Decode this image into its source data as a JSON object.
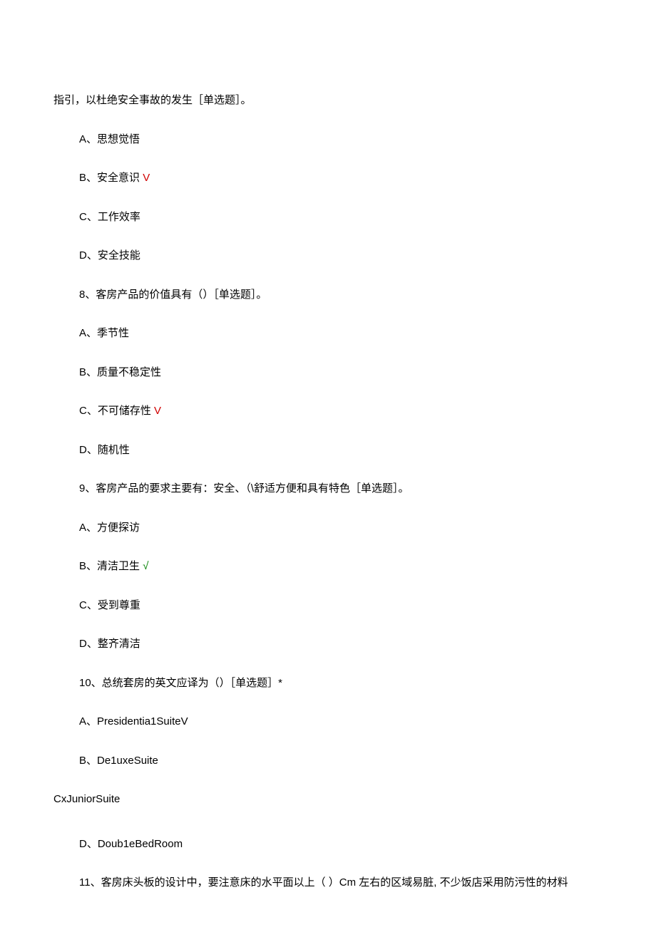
{
  "continued_line": "指引，以杜绝安全事故的发生［单选题］。",
  "q7_options": {
    "A": {
      "text": "A、思想觉悟",
      "mark": ""
    },
    "B": {
      "text": "B、安全意识 ",
      "mark": "V",
      "mark_color": "red"
    },
    "C": {
      "text": "C、工作效率",
      "mark": ""
    },
    "D": {
      "text": "D、安全技能",
      "mark": ""
    }
  },
  "q8": {
    "stem": "8、客房产品的价值具有（）［单选题］。",
    "A": {
      "text": "A、季节性",
      "mark": ""
    },
    "B": {
      "text": "B、质量不稳定性",
      "mark": ""
    },
    "C": {
      "text": "C、不可储存性 ",
      "mark": "V",
      "mark_color": "red"
    },
    "D": {
      "text": "D、随机性",
      "mark": ""
    }
  },
  "q9": {
    "stem": "9、客房产品的要求主要有：安全、（\\舒适方便和具有特色［单选题］。",
    "A": {
      "text": "A、方便探访",
      "mark": ""
    },
    "B": {
      "text": "B、清洁卫生 ",
      "mark": "√",
      "mark_color": "green"
    },
    "C": {
      "text": "C、受到尊重",
      "mark": ""
    },
    "D": {
      "text": "D、整齐清洁",
      "mark": ""
    }
  },
  "q10": {
    "stem": "10、总统套房的英文应译为（）［单选题］*",
    "A": {
      "text": "A、Presidentia1SuiteV",
      "mark": ""
    },
    "B": {
      "text": "B、De1uxeSuite",
      "mark": ""
    },
    "C": {
      "text": "CxJuniorSuite",
      "mark": ""
    },
    "D": {
      "text": "D、Doub1eBedRoom",
      "mark": ""
    }
  },
  "q11": {
    "stem": "11、客房床头板的设计中，要注意床的水平面以上（  ）Cm 左右的区域易脏, 不少饭店采用防污性的材料"
  }
}
